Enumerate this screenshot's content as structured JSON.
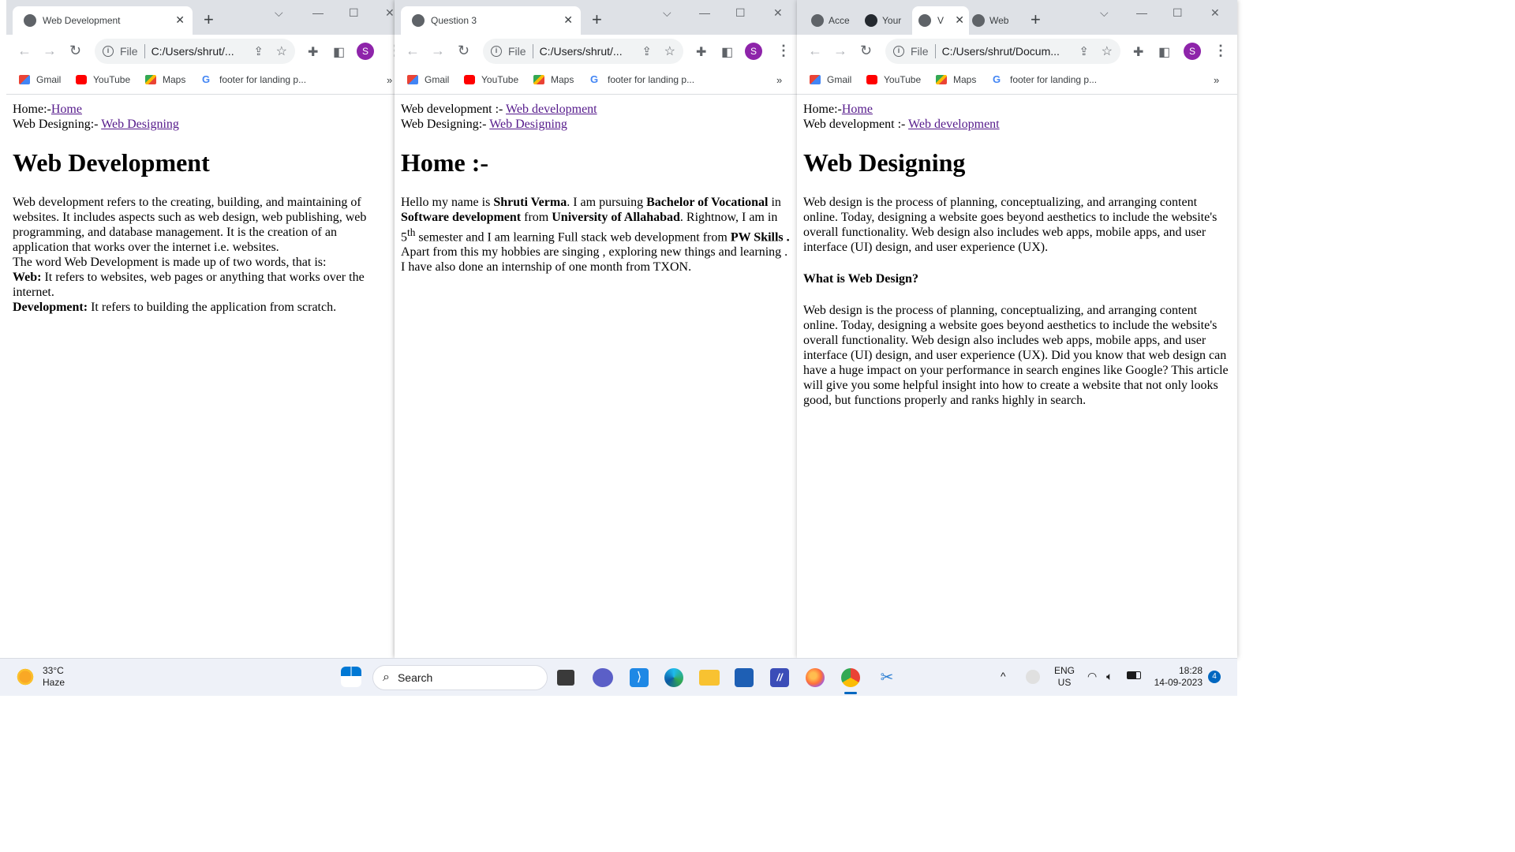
{
  "windows": [
    {
      "id": "win1",
      "tab_title": "Web Development",
      "url": "C:/Users/shrut/...",
      "file_label": "File",
      "avatar": "S",
      "bookmarks": [
        "Gmail",
        "YouTube",
        "Maps",
        "footer for landing p..."
      ],
      "bookmarks_more": "»",
      "page": {
        "nav1_label": "Home:-",
        "nav1_link": "Home",
        "nav2_label": "Web Designing:- ",
        "nav2_link": "Web Designing",
        "heading": "Web Development",
        "body1": "Web development refers to the creating, building, and maintaining of websites. It includes aspects such as web design, web publishing, web programming, and database management. It is the creation of an application that works over the internet i.e. websites.",
        "body2": "The word Web Development is made up of two words, that is:",
        "web_label": "Web:",
        "web_text": " It refers to websites, web pages or anything that works over the internet.",
        "dev_label": "Development:",
        "dev_text": " It refers to building the application from scratch."
      }
    },
    {
      "id": "win2",
      "tab_title": "Question 3",
      "url": "C:/Users/shrut/...",
      "file_label": "File",
      "avatar": "S",
      "bookmarks": [
        "Gmail",
        "YouTube",
        "Maps",
        "footer for landing p..."
      ],
      "bookmarks_more": "»",
      "page": {
        "nav1_label": "Web development :- ",
        "nav1_link": "Web development",
        "nav2_label": "Web Designing:- ",
        "nav2_link": "Web Designing",
        "heading": "Home :-",
        "t1": "Hello my name is ",
        "b1": "Shruti Verma",
        "t2": ". I am pursuing ",
        "b2": "Bachelor of Vocational",
        "t3": " in ",
        "b3": "Software development",
        "t4": " from ",
        "b4": "University of Allahabad",
        "t5": ". Rightnow, I am in ",
        "sem": "5",
        "sup": "th",
        "t6": " semester and I am learning Full stack web development from ",
        "b5": "PW Skills .",
        "t7": " Apart from this my hobbies are singing , exploring new things and learning . I have also done an internship of one month from TXON."
      }
    },
    {
      "id": "win3",
      "tabs": [
        "Acce",
        "Your",
        "V",
        "Web"
      ],
      "url": "C:/Users/shrut/Docum...",
      "file_label": "File",
      "avatar": "S",
      "bookmarks": [
        "Gmail",
        "YouTube",
        "Maps",
        "footer for landing p..."
      ],
      "bookmarks_more": "»",
      "page": {
        "nav1_label": "Home:-",
        "nav1_link": "Home",
        "nav2_label": "Web development :- ",
        "nav2_link": "Web development",
        "heading": "Web Designing",
        "body1": "Web design is the process of planning, conceptualizing, and arranging content online. Today, designing a website goes beyond aesthetics to include the website's overall functionality. Web design also includes web apps, mobile apps, and user interface (UI) design, and user experience (UX).",
        "subheading": "What is Web Design?",
        "body2": "Web design is the process of planning, conceptualizing, and arranging content online. Today, designing a website goes beyond aesthetics to include the website's overall functionality. Web design also includes web apps, mobile apps, and user interface (UI) design, and user experience (UX). Did you know that web design can have a huge impact on your performance in search engines like Google? This article will give you some helpful insight into how to create a website that not only looks good, but functions properly and ranks highly in search."
      }
    }
  ],
  "taskbar": {
    "temperature": "33°C",
    "weather": "Haze",
    "search_placeholder": "Search",
    "lang1": "ENG",
    "lang2": "US",
    "time": "18:28",
    "date": "14-09-2023",
    "notifications": "4"
  },
  "colors": {
    "tabstrip": "#dee1e6",
    "link": "#551a8b",
    "avatar": "#8e24aa",
    "taskbar": "#eef1f8"
  }
}
